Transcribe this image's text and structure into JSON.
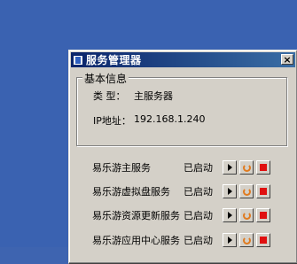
{
  "window": {
    "title": "服务管理器",
    "close_label": "×"
  },
  "basic_info": {
    "legend": "基本信息",
    "type_label": "类  型：",
    "type_value": "主服务器",
    "ip_label": "IP地址：",
    "ip_value": "192.168.1.240"
  },
  "services": [
    {
      "name": "易乐游主服务",
      "status": "已启动"
    },
    {
      "name": "易乐游虚拟盘服务",
      "status": "已启动"
    },
    {
      "name": "易乐游资源更新服务",
      "status": "已启动"
    },
    {
      "name": "易乐游应用中心服务",
      "status": "已启动"
    }
  ],
  "icons": {
    "start": "play-icon",
    "restart": "restart-icon",
    "stop": "stop-icon"
  },
  "colors": {
    "desktop": "#3a62b1",
    "titlebar": "#0a246a",
    "stop": "#e01010",
    "restart": "#e07b20"
  }
}
